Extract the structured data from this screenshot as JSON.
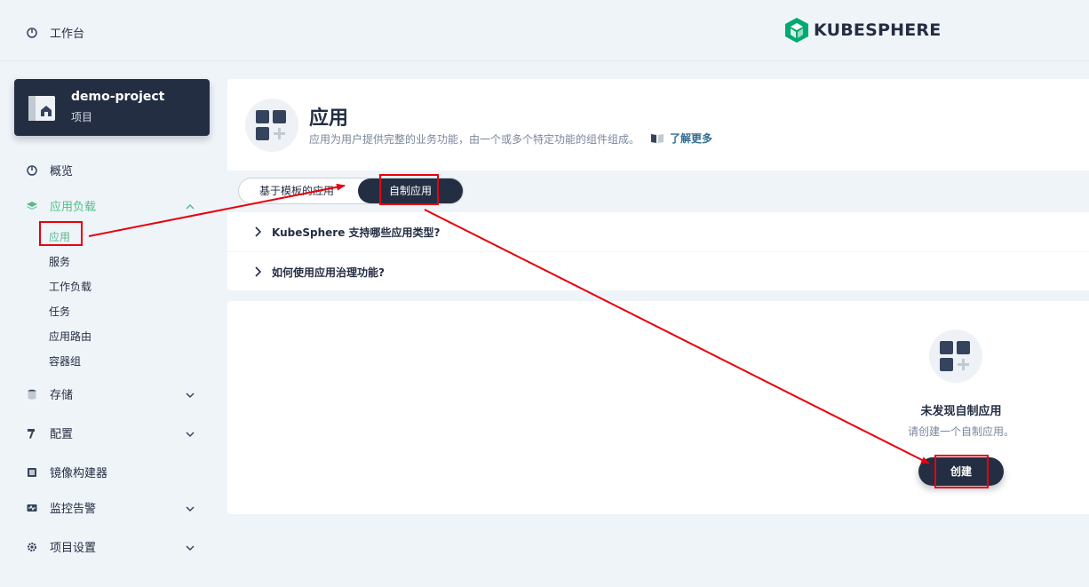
{
  "topbar": {
    "workbench_label": "工作台",
    "logo_text": "KUBESPHERE"
  },
  "project": {
    "name": "demo-project",
    "type": "项目"
  },
  "sidebar": {
    "overview": "概览",
    "app_workloads": "应用负载",
    "app_workloads_children": [
      "应用",
      "服务",
      "工作负载",
      "任务",
      "应用路由",
      "容器组"
    ],
    "storage": "存储",
    "config": "配置",
    "image_builder": "镜像构建器",
    "monitoring": "监控告警",
    "project_settings": "项目设置"
  },
  "header": {
    "title": "应用",
    "description": "应用为用户提供完整的业务功能，由一个或多个特定功能的组件组成。",
    "learn_more": "了解更多",
    "tabs": [
      "基于模板的应用",
      "自制应用"
    ],
    "active_tab": "自制应用",
    "faq": [
      "KubeSphere 支持哪些应用类型?",
      "如何使用应用治理功能?"
    ]
  },
  "empty_state": {
    "title": "未发现自制应用",
    "description": "请创建一个自制应用。",
    "create_button": "创建"
  },
  "colors": {
    "dark": "#242e42",
    "accent_green": "#55bc8a",
    "annotation_red": "#e8000b",
    "background": "#eff4f9"
  }
}
